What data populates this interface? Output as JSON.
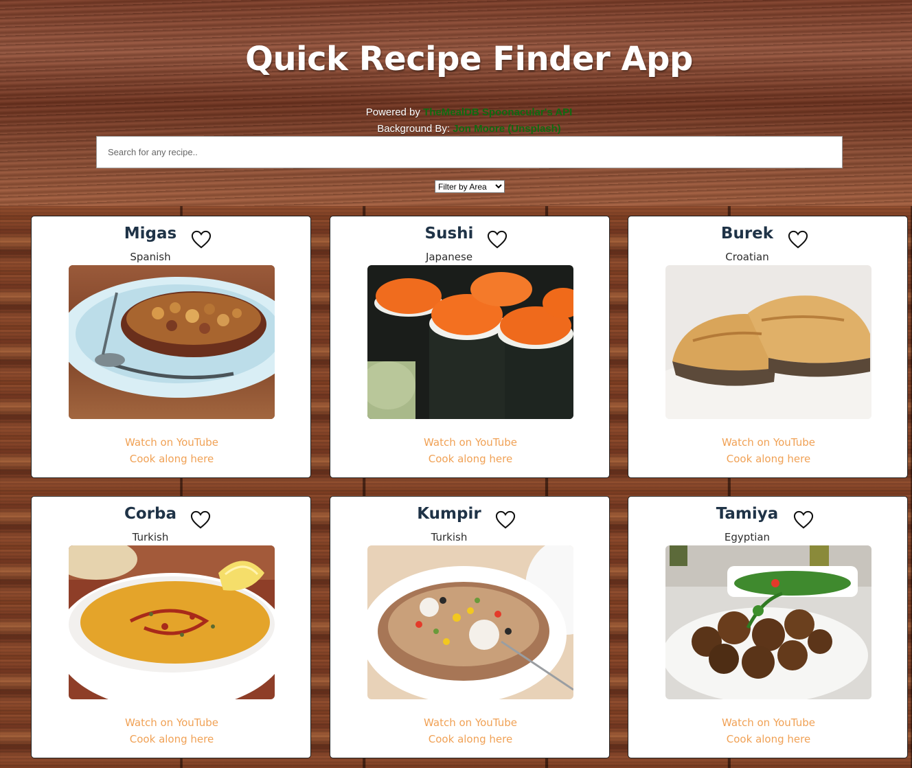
{
  "header": {
    "title": "Quick Recipe Finder App",
    "powered_prefix": "Powered by",
    "powered_link": "TheMealDB Spoonacular's API",
    "background_prefix": "Background By:",
    "background_link": "Jon Moore (Unsplash)"
  },
  "search": {
    "placeholder": "Search for any recipe..",
    "value": ""
  },
  "filter": {
    "selected": "Filter by Area"
  },
  "card_actions": {
    "youtube_label": "Watch on YouTube",
    "cook_label": "Cook along here"
  },
  "meals": [
    {
      "name": "Migas",
      "area": "Spanish",
      "photo_icon": "migas-dish"
    },
    {
      "name": "Sushi",
      "area": "Japanese",
      "photo_icon": "sushi-rolls"
    },
    {
      "name": "Burek",
      "area": "Croatian",
      "photo_icon": "burek-pastry"
    },
    {
      "name": "Corba",
      "area": "Turkish",
      "photo_icon": "lentil-soup"
    },
    {
      "name": "Kumpir",
      "area": "Turkish",
      "photo_icon": "stuffed-potato"
    },
    {
      "name": "Tamiya",
      "area": "Egyptian",
      "photo_icon": "falafel-plate"
    }
  ],
  "colors": {
    "link_green": "#0f6b10",
    "card_link_orange": "#f0a155",
    "meal_name": "#1f3347"
  }
}
